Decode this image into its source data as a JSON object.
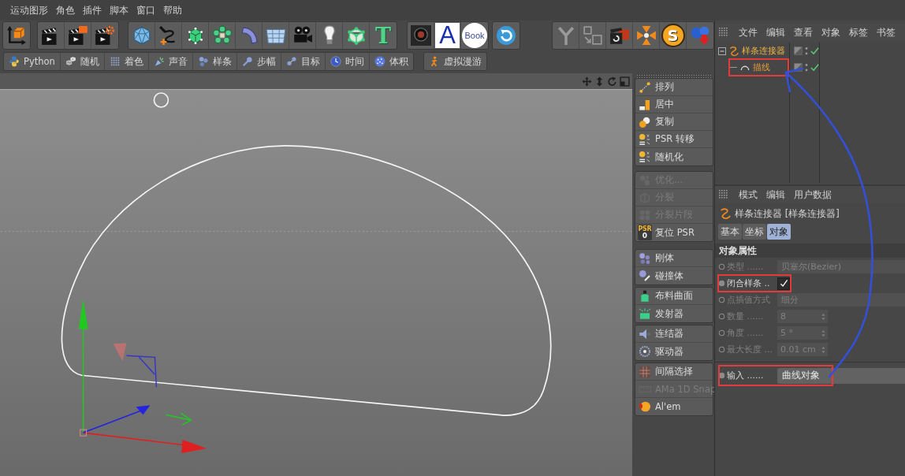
{
  "menu_bar": [
    "运动图形",
    "角色",
    "插件",
    "脚本",
    "窗口",
    "帮助"
  ],
  "main_toolbar": {
    "glyphs": [
      "T",
      "A",
      "Book",
      "S"
    ]
  },
  "command_toolbar": {
    "groups": [
      {
        "items": [
          "Python",
          "随机",
          "着色",
          "声音",
          "样条",
          "步幅",
          "目标",
          "时间",
          "体积"
        ]
      },
      {
        "items": [
          "虚拟漫游"
        ]
      }
    ]
  },
  "command_palette": {
    "groups": [
      {
        "items": [
          {
            "label": "排列",
            "disabled": false
          },
          {
            "label": "居中",
            "disabled": false
          },
          {
            "label": "复制",
            "disabled": false
          },
          {
            "label": "PSR 转移",
            "disabled": false
          },
          {
            "label": "随机化",
            "disabled": false
          }
        ]
      },
      {
        "items": [
          {
            "label": "优化...",
            "disabled": true
          },
          {
            "label": "分裂",
            "disabled": true
          },
          {
            "label": "分裂片段",
            "disabled": true
          },
          {
            "label": "复位 PSR",
            "disabled": false,
            "icon_text": "PSR",
            "icon_value": "0"
          }
        ]
      },
      {
        "items": [
          {
            "label": "刚体",
            "disabled": false
          },
          {
            "label": "碰撞体",
            "disabled": false
          }
        ]
      },
      {
        "items": [
          {
            "label": "布料曲面",
            "disabled": false
          },
          {
            "label": "发射器",
            "disabled": false
          }
        ]
      },
      {
        "items": [
          {
            "label": "连结器",
            "disabled": false
          },
          {
            "label": "驱动器",
            "disabled": false
          }
        ]
      },
      {
        "items": [
          {
            "label": "间隔选择",
            "disabled": false
          },
          {
            "label": "AMa 1D Snap",
            "disabled": true
          },
          {
            "label": "Al'em",
            "disabled": false
          }
        ]
      }
    ]
  },
  "object_manager": {
    "menu": [
      "文件",
      "编辑",
      "查看",
      "对象",
      "标签",
      "书签"
    ],
    "tree": [
      {
        "name": "样条连接器",
        "selected": true,
        "expanded": true,
        "enabled": true,
        "children": [
          {
            "name": "描线",
            "selected": true,
            "enabled": true,
            "highlighted": true
          }
        ]
      }
    ]
  },
  "attribute_manager": {
    "menu": [
      "模式",
      "编辑",
      "用户数据"
    ],
    "object_title": "样条连接器 [样条连接器]",
    "tabs": [
      {
        "label": "基本",
        "selected": false
      },
      {
        "label": "坐标",
        "selected": false
      },
      {
        "label": "对象",
        "selected": true
      }
    ],
    "section": "对象属性",
    "field_groups": [
      {
        "fields": [
          {
            "kind": "dropdown",
            "label": "类型 ......",
            "value": "贝塞尔(Bezier)",
            "disabled": true
          },
          {
            "kind": "checkbox",
            "label": "闭合样条 ..",
            "checked": true,
            "disabled": false,
            "highlighted": true
          },
          {
            "kind": "dropdown",
            "label": "点插值方式",
            "value": "细分",
            "disabled": true
          },
          {
            "kind": "number",
            "label": "数量 ......",
            "value": "8",
            "disabled": true
          },
          {
            "kind": "number",
            "label": "角度 ......",
            "value": "5 °",
            "disabled": true
          },
          {
            "kind": "number",
            "label": "最大长度 ...",
            "value": "0.01 cm",
            "disabled": true
          }
        ]
      },
      {
        "fields": [
          {
            "kind": "link",
            "label": "输入 ......",
            "value": "曲线对象",
            "disabled": false,
            "highlighted": true
          }
        ]
      }
    ]
  }
}
